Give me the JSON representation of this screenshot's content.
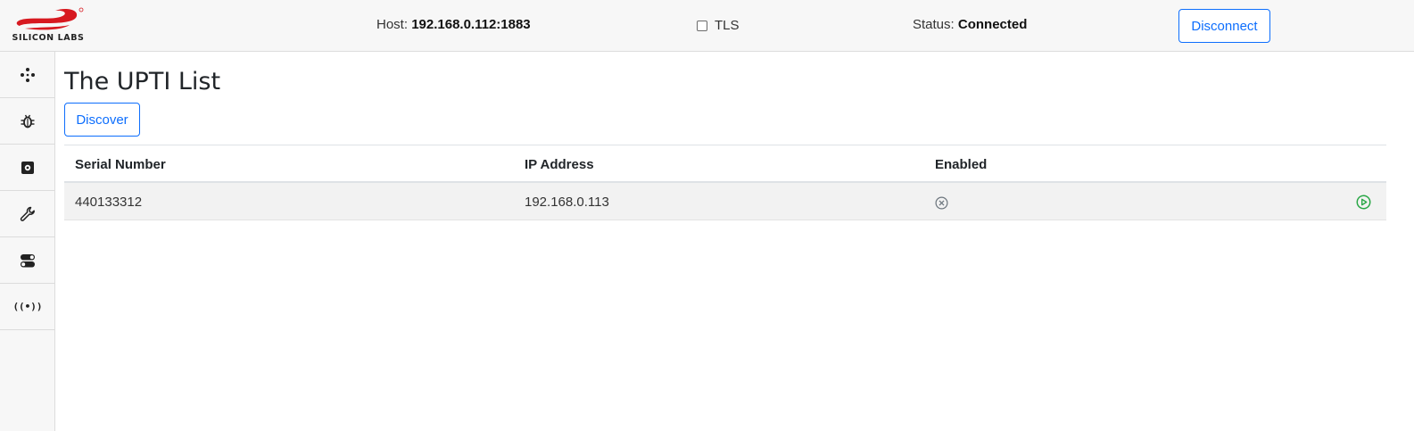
{
  "brand": {
    "logo_text": "SILICON LABS",
    "logo_color": "#d71920"
  },
  "header": {
    "host_label": "Host:",
    "host_value": "192.168.0.112:1883",
    "tls_label": "TLS",
    "tls_checked": false,
    "status_label": "Status:",
    "status_value": "Connected",
    "disconnect_label": "Disconnect"
  },
  "sidebar": {
    "items": [
      {
        "icon": "nodes-icon"
      },
      {
        "icon": "bug-icon"
      },
      {
        "icon": "settings-chip-icon"
      },
      {
        "icon": "wrench-icon"
      },
      {
        "icon": "toggles-icon"
      },
      {
        "icon": "broadcast-icon",
        "glyph": "((•))"
      }
    ]
  },
  "main": {
    "title": "The UPTI List",
    "discover_label": "Discover",
    "table": {
      "columns": [
        "Serial Number",
        "IP Address",
        "Enabled"
      ],
      "rows": [
        {
          "serial": "440133312",
          "ip": "192.168.0.113",
          "enabled": false
        }
      ]
    }
  },
  "colors": {
    "accent": "#0d6efd",
    "play": "#28a745",
    "disabled_icon": "#6c757d"
  }
}
